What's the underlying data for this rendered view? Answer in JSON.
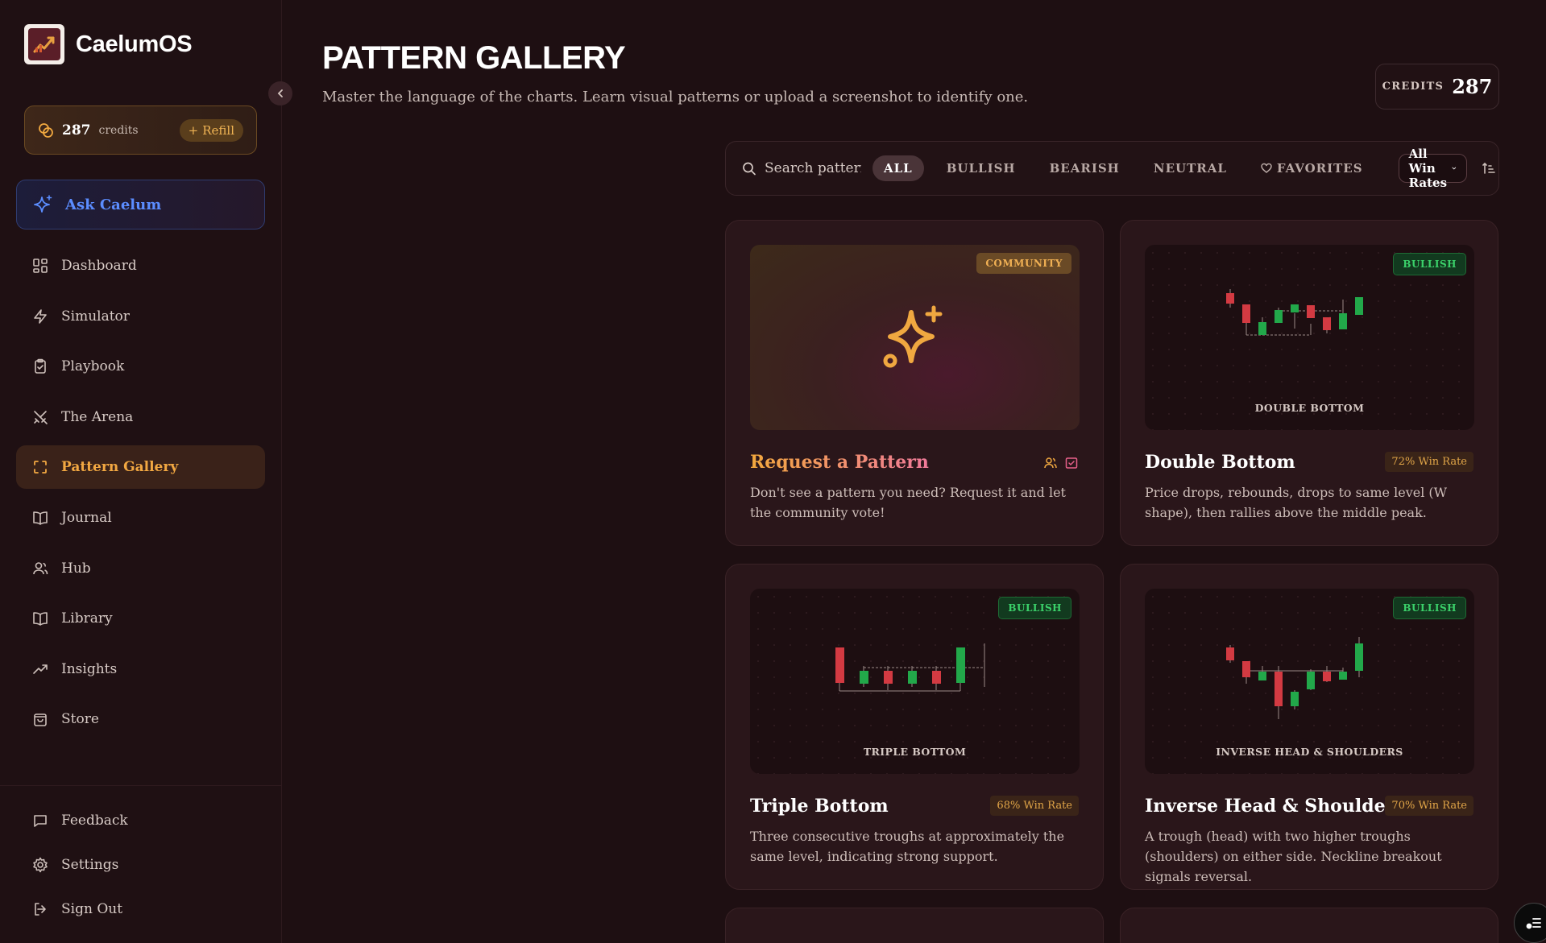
{
  "brand": {
    "name": "CaelumOS"
  },
  "credits_card": {
    "amount": "287",
    "label": "credits",
    "refill_label": "Refill"
  },
  "ask": {
    "label": "Ask Caelum"
  },
  "nav": [
    {
      "label": "Dashboard",
      "icon": "grid-icon"
    },
    {
      "label": "Simulator",
      "icon": "lightning-icon"
    },
    {
      "label": "Playbook",
      "icon": "clipboard-icon"
    },
    {
      "label": "The Arena",
      "icon": "swords-icon"
    },
    {
      "label": "Pattern Gallery",
      "icon": "scan-icon",
      "active": true
    },
    {
      "label": "Journal",
      "icon": "book-icon"
    },
    {
      "label": "Hub",
      "icon": "users-icon"
    },
    {
      "label": "Library",
      "icon": "book-open-icon"
    },
    {
      "label": "Insights",
      "icon": "trending-icon"
    },
    {
      "label": "Store",
      "icon": "shopping-bag-icon"
    }
  ],
  "bottom_nav": [
    {
      "label": "Feedback",
      "icon": "message-icon"
    },
    {
      "label": "Settings",
      "icon": "gear-icon"
    },
    {
      "label": "Sign Out",
      "icon": "logout-icon"
    }
  ],
  "header": {
    "title": "PATTERN GALLERY",
    "subtitle": "Master the language of the charts. Learn visual patterns or upload a screenshot to identify one.",
    "credits_label": "CREDITS",
    "credits_value": "287"
  },
  "filters": {
    "search_placeholder": "Search patterns...",
    "chips": [
      "ALL",
      "BULLISH",
      "BEARISH",
      "NEUTRAL",
      "FAVORITES"
    ],
    "active_chip": "ALL",
    "win_rate_select": "All Win Rates"
  },
  "cards": [
    {
      "title": "Request a Pattern",
      "badge": "COMMUNITY",
      "description": "Don't see a pattern you need? Request it and let the community vote!"
    },
    {
      "title": "Double Bottom",
      "badge": "BULLISH",
      "caption": "DOUBLE BOTTOM",
      "win_rate": "72% Win Rate",
      "description": "Price drops, rebounds, drops to same level (W shape), then rallies above the middle peak."
    },
    {
      "title": "Triple Bottom",
      "badge": "BULLISH",
      "caption": "TRIPLE BOTTOM",
      "win_rate": "68% Win Rate",
      "description": "Three consecutive troughs at approximately the same level, indicating strong support."
    },
    {
      "title": "Inverse Head & Shoulders",
      "badge": "BULLISH",
      "caption": "INVERSE HEAD & SHOULDERS",
      "win_rate": "70% Win Rate",
      "description": "A trough (head) with two higher troughs (shoulders) on either side. Neckline breakout signals reversal."
    }
  ],
  "colors": {
    "accent": "#f2a842",
    "bullish": "#22a84a",
    "bearish": "#d33a42",
    "background": "#1e0f12"
  }
}
